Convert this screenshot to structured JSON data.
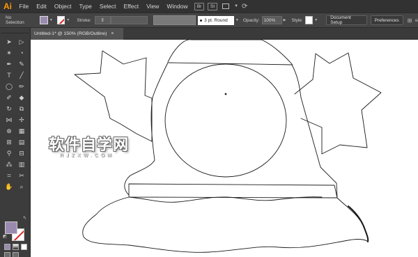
{
  "app": {
    "logo": "Ai",
    "menu": [
      "File",
      "Edit",
      "Object",
      "Type",
      "Select",
      "Effect",
      "View",
      "Window"
    ],
    "bridge_label": "Br",
    "stock_label": "St"
  },
  "control_bar": {
    "selection_label": "No Selection",
    "stroke_label": "Stroke:",
    "brush_label": "3 pt. Round",
    "opacity_label": "Opacity:",
    "opacity_value": "100%",
    "style_label": "Style:",
    "document_setup": "Document Setup",
    "preferences": "Preferences",
    "fill_color": "#9b8ab0",
    "stroke_color": "none"
  },
  "document": {
    "tab_title": "Untitled-1* @ 150% (RGB/Outline)",
    "close_symbol": "×"
  },
  "watermark": {
    "main": "软件自学网",
    "sub": "RJZXW.COM"
  }
}
